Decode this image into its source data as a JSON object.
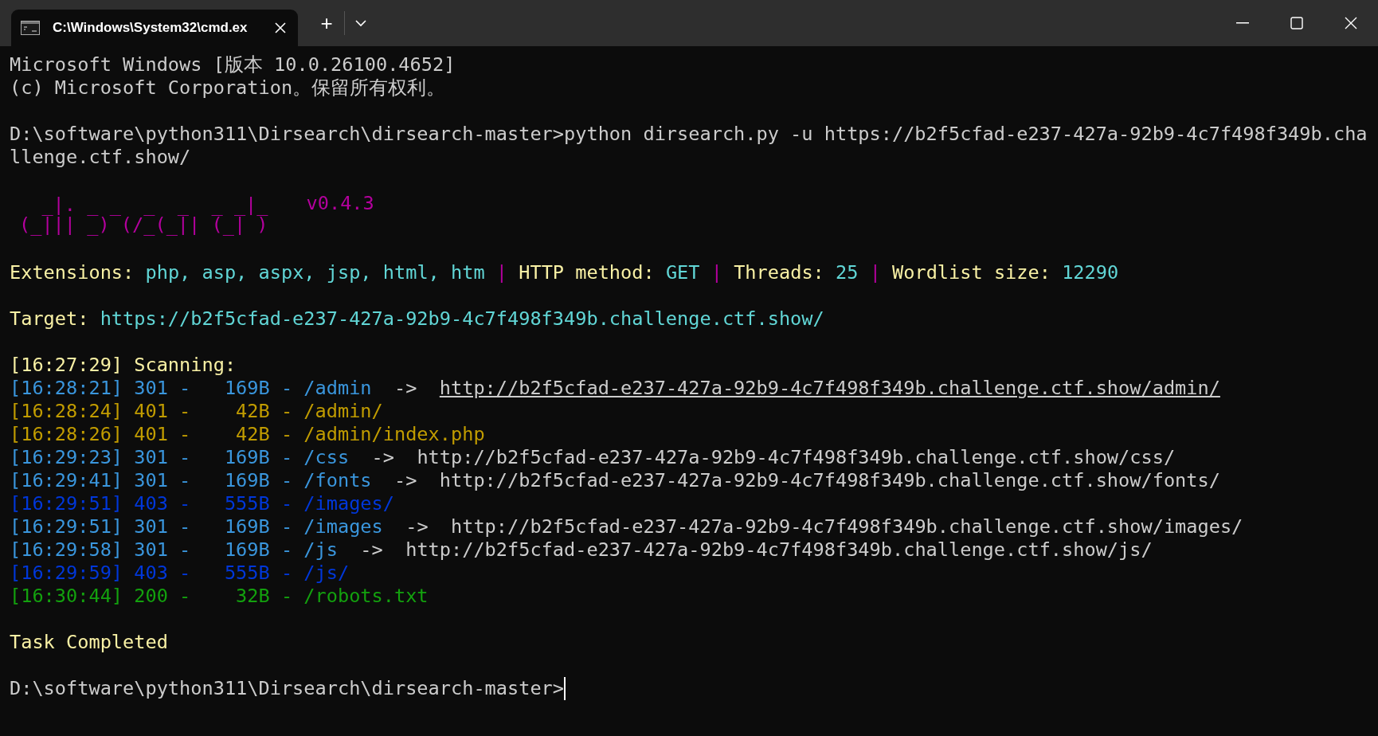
{
  "window": {
    "tab_title": "C:\\Windows\\System32\\cmd.ex",
    "new_tab": "+"
  },
  "console": {
    "lines": [
      {
        "kind": "text",
        "segments": [
          {
            "kind": "plain",
            "text": "Microsoft Windows [版本 10.0.26100.4652]"
          }
        ]
      },
      {
        "kind": "text",
        "segments": [
          {
            "kind": "plain",
            "text": "(c) Microsoft Corporation。保留所有权利。"
          }
        ]
      },
      {
        "kind": "blank"
      },
      {
        "kind": "text",
        "segments": [
          {
            "kind": "plain",
            "text": "D:\\software\\python311\\Dirsearch\\dirsearch-master>python dirsearch.py -u https://b2f5cfad-e237-427a-92b9-4c7f498f349b.cha"
          }
        ]
      },
      {
        "kind": "text",
        "segments": [
          {
            "kind": "plain",
            "text": "llenge.ctf.show/"
          }
        ]
      },
      {
        "kind": "blank"
      },
      {
        "kind": "banner",
        "art": [
          "  _|. _ _  _  _  _ _|_",
          "(_||| _) (/_(_|| (_| )"
        ],
        "version": "v0.4.3"
      },
      {
        "kind": "blank"
      },
      {
        "kind": "text",
        "segments": [
          {
            "kind": "key",
            "text": "Extensions: "
          },
          {
            "kind": "value",
            "text": "php, asp, aspx, jsp, html, htm"
          },
          {
            "kind": "sep",
            "text": " | "
          },
          {
            "kind": "key",
            "text": "HTTP method: "
          },
          {
            "kind": "value",
            "text": "GET"
          },
          {
            "kind": "sep",
            "text": " | "
          },
          {
            "kind": "key",
            "text": "Threads: "
          },
          {
            "kind": "value",
            "text": "25"
          },
          {
            "kind": "sep",
            "text": " | "
          },
          {
            "kind": "key",
            "text": "Wordlist size: "
          },
          {
            "kind": "value",
            "text": "12290"
          }
        ]
      },
      {
        "kind": "blank"
      },
      {
        "kind": "text",
        "segments": [
          {
            "kind": "key",
            "text": "Target: "
          },
          {
            "kind": "value",
            "text": "https://b2f5cfad-e237-427a-92b9-4c7f498f349b.challenge.ctf.show/"
          }
        ]
      },
      {
        "kind": "blank"
      },
      {
        "kind": "text",
        "segments": [
          {
            "kind": "key",
            "text": "[16:27:29] Scanning:"
          }
        ]
      },
      {
        "kind": "result",
        "color": "#3a96dd",
        "text": "[16:28:21] 301 -   169B - /admin",
        "arrow": "->",
        "redirect": "http://b2f5cfad-e237-427a-92b9-4c7f498f349b.challenge.ctf.show/admin/",
        "underlined": true
      },
      {
        "kind": "result",
        "color": "#c19c00",
        "text": "[16:28:24] 401 -    42B - /admin/"
      },
      {
        "kind": "result",
        "color": "#c19c00",
        "text": "[16:28:26] 401 -    42B - /admin/index.php"
      },
      {
        "kind": "result",
        "color": "#3a96dd",
        "text": "[16:29:23] 301 -   169B - /css",
        "arrow": "->",
        "redirect": "http://b2f5cfad-e237-427a-92b9-4c7f498f349b.challenge.ctf.show/css/",
        "underlined": false
      },
      {
        "kind": "result",
        "color": "#3a96dd",
        "text": "[16:29:41] 301 -   169B - /fonts",
        "arrow": "->",
        "redirect": "http://b2f5cfad-e237-427a-92b9-4c7f498f349b.challenge.ctf.show/fonts/",
        "underlined": false
      },
      {
        "kind": "result",
        "color": "#0037da",
        "text": "[16:29:51] 403 -   555B - /images/"
      },
      {
        "kind": "result",
        "color": "#3a96dd",
        "text": "[16:29:51] 301 -   169B - /images",
        "arrow": "->",
        "redirect": "http://b2f5cfad-e237-427a-92b9-4c7f498f349b.challenge.ctf.show/images/",
        "underlined": false
      },
      {
        "kind": "result",
        "color": "#3a96dd",
        "text": "[16:29:58] 301 -   169B - /js",
        "arrow": "->",
        "redirect": "http://b2f5cfad-e237-427a-92b9-4c7f498f349b.challenge.ctf.show/js/",
        "underlined": false
      },
      {
        "kind": "result",
        "color": "#0037da",
        "text": "[16:29:59] 403 -   555B - /js/"
      },
      {
        "kind": "result",
        "color": "#13a10e",
        "text": "[16:30:44] 200 -    32B - /robots.txt"
      },
      {
        "kind": "blank"
      },
      {
        "kind": "text",
        "segments": [
          {
            "kind": "key",
            "text": "Task Completed"
          }
        ]
      },
      {
        "kind": "blank"
      },
      {
        "kind": "prompt",
        "text": "D:\\software\\python311\\Dirsearch\\dirsearch-master>",
        "cursor": true
      }
    ]
  }
}
